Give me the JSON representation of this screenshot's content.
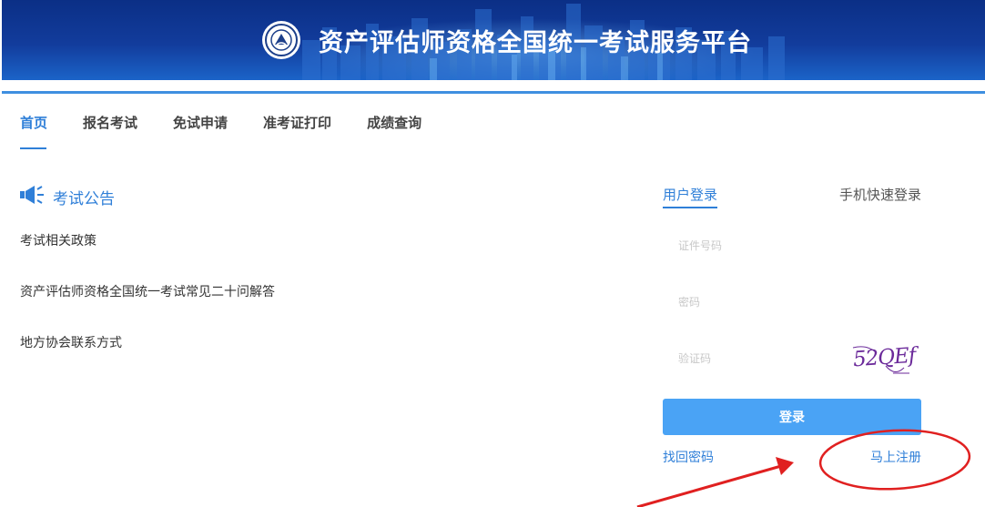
{
  "banner": {
    "title": "资产评估师资格全国统一考试服务平台",
    "logo_icon": "emblem-logo-icon"
  },
  "nav": {
    "items": [
      {
        "label": "首页",
        "active": true
      },
      {
        "label": "报名考试",
        "active": false
      },
      {
        "label": "免试申请",
        "active": false
      },
      {
        "label": "准考证打印",
        "active": false
      },
      {
        "label": "成绩查询",
        "active": false
      }
    ]
  },
  "notices": {
    "title": "考试公告",
    "icon": "megaphone-icon",
    "items": [
      "考试相关政策",
      "资产评估师资格全国统一考试常见二十问解答",
      "地方协会联系方式"
    ]
  },
  "login": {
    "tabs": {
      "user": "用户登录",
      "phone": "手机快速登录"
    },
    "id_placeholder": "证件号码",
    "password_placeholder": "密码",
    "captcha_placeholder": "验证码",
    "captcha_text": "52QEf",
    "submit_label": "登录",
    "forgot_label": "找回密码",
    "register_label": "马上注册"
  },
  "colors": {
    "accent": "#2f7fd8",
    "button": "#4aa3f5",
    "banner": "#0b2f86",
    "annotation": "#e02020"
  }
}
